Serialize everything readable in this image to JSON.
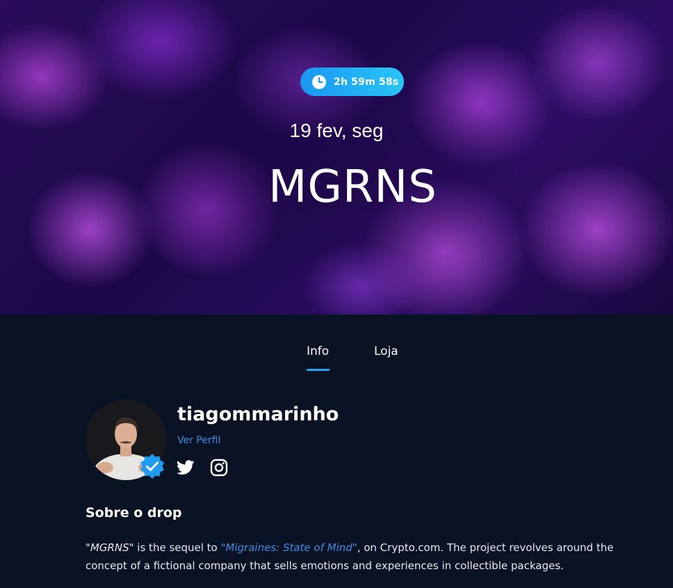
{
  "hero": {
    "countdown": "2h 59m 58s",
    "date": "19 fev, seg",
    "title": "MGRNS"
  },
  "tabs": [
    {
      "label": "Info",
      "active": true
    },
    {
      "label": "Loja",
      "active": false
    }
  ],
  "profile": {
    "username": "tiagommarinho",
    "view_profile_label": "Ver Perfil",
    "verified": true,
    "socials": [
      "twitter-icon",
      "instagram-icon"
    ]
  },
  "about": {
    "heading": "Sobre o drop",
    "quote_open": "\"",
    "drop_name": "MGRNS",
    "part1": "\" is the sequel to ",
    "link_text": "\"Migraines: State of Mind\"",
    "part2": ", on Crypto.com. The project revolves around the concept of a fictional company that sells emotions and experiences in collectible packages."
  },
  "colors": {
    "background": "#0a1324",
    "accent": "#22a6f0",
    "link": "#3d8ce4"
  }
}
